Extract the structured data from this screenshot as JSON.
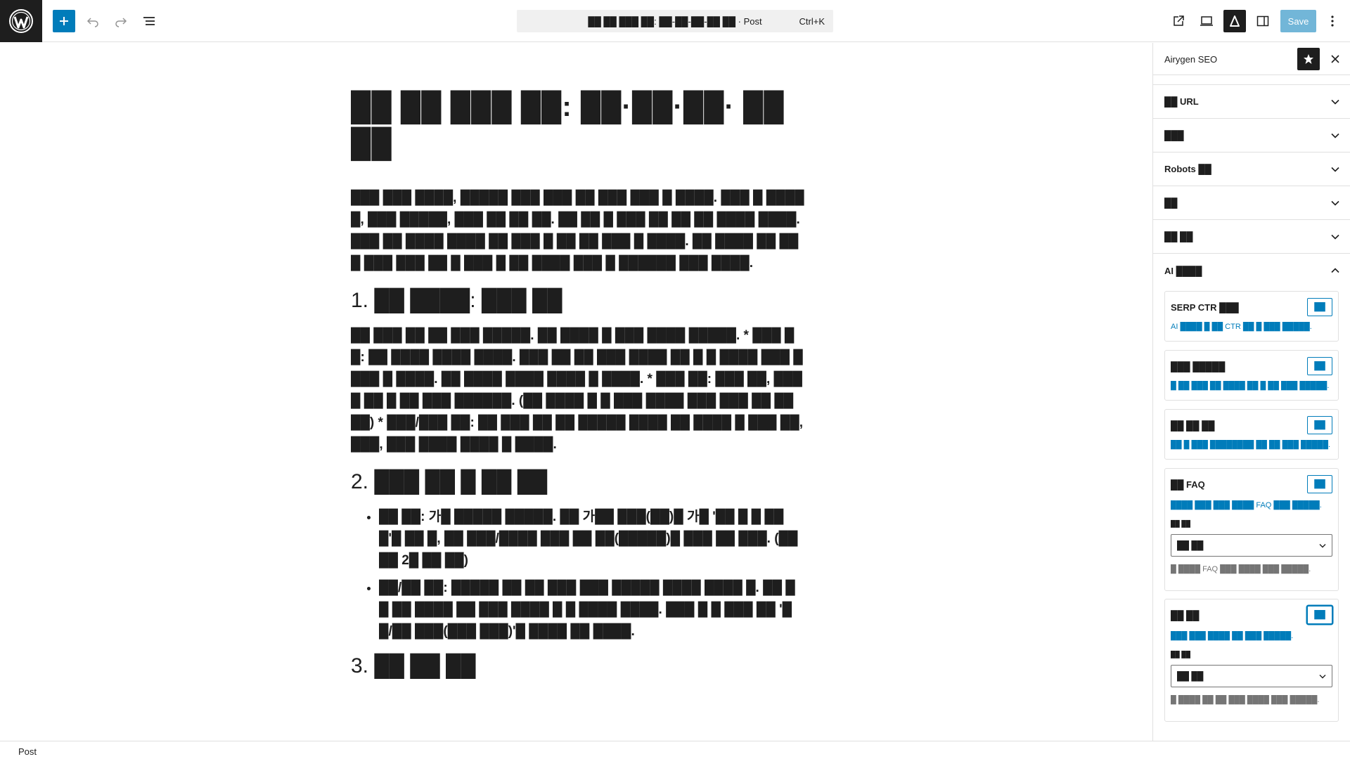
{
  "topbar": {
    "command_title": "██ ██ ███ ██: ██-██-██-██ ██ · Post",
    "command_shortcut": "Ctrl+K",
    "save_label": "Save"
  },
  "post": {
    "title": "██ ██ ███ ██: ██·██·██· ██ ██",
    "intro": "███ ███ ████, █████ ███ ███ ██ ███ ███ █ ████. ███ █ █████, ███ █████, ███ ██ ██ ██. ██ ██ █ ███ ██ ██ ██ ████ ████. ███ ██ ████ ████ ██ ███ █ ██ ██ ███ █ ████. ██ ████ ██ ███ ███ ███ ██ █ ███ █ ██ ████ ███ █ ██████ ███ ████.",
    "h1": "1. ██ ████: ███ ██",
    "p1": "██ ███ ██ ██ ███ █████. ██ ████ █ ███ ████ █████. * ███ ██: ██ ████ ████ ████. ███ ██ ██ ███ ████ ██ █ █ ████ ███ ████ █ ████. ██ ████ ████ ████ █ ████. * ███ ██: ███ ██, ████ ██ █ ██ ███ ██████. (██ ████ █ █ ███ ████ ███ ███ ██ ██ ██) * ███/███ ██: ██ ███ ██ ██ █████ ████ ██ ████ █ ███ ██, ███, ███ ████ ████ █ ████.",
    "h2": "2. ███ ██ █ ██ ██",
    "bullets": [
      "██ ██: 가█ █████ █████. ██ 가██ ███(██)█ 가█ '██ █ █ ███'█ ██ █, ██ ███/████ ███ ██ ██(█████)█ ███ ██ ███. (██ ██ 2█ ██ ██)",
      "██/██ ██: █████ ██ ██ ███ ███ █████ ████ ████ █. ██ ██ ██ ████ ██ ███ ████ █ █ ████ ████. ███ █ █ ███ ██ '██/██ ███(███ ███)'█ ████ ██ ████."
    ],
    "h3": "3. ██ ██ ██"
  },
  "sidebar": {
    "title": "Airygen SEO",
    "panels": [
      "██ URL",
      "███",
      "Robots ██",
      "██",
      "██ ██",
      "AI ████"
    ],
    "cards": [
      {
        "title": "SERP CTR ███",
        "button": "██",
        "desc": "AI ████ █ ██ CTR ██ █ ███ █████."
      },
      {
        "title": "███ █████",
        "button": "██",
        "desc": "█ ██ ███ ██ ████ ██ █ ██ ███ █████."
      },
      {
        "title": "██ ██ ██",
        "button": "██",
        "desc": "██ █ ███ ████████ ██ ██ ███ █████."
      },
      {
        "title": "██ FAQ",
        "button": "██",
        "desc": "████ ███ ███ ████ FAQ ███ █████.",
        "label": "██ ██",
        "select": "██ ██",
        "help": "█ ████ FAQ ███ ████ ███ █████."
      },
      {
        "title": "██ ██",
        "button": "██",
        "desc": "███ ███ ████ ██ ███ █████.",
        "label": "██ ██",
        "select": "██ ██",
        "help": "█ ████ ██ ██ ███ ████ ███ █████."
      }
    ]
  },
  "statusbar": {
    "label": "Post"
  }
}
